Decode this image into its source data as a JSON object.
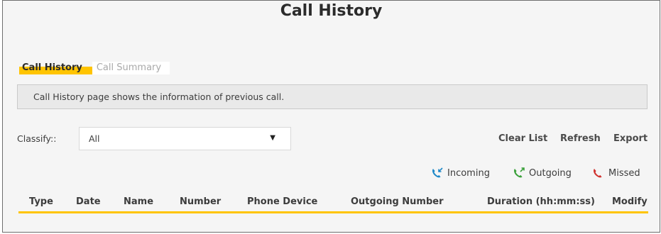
{
  "page": {
    "title": "Call History"
  },
  "tabs": [
    {
      "label": "Call History",
      "active": true
    },
    {
      "label": "Call Summary",
      "active": false
    }
  ],
  "info": {
    "text": "Call History page shows the information of previous call."
  },
  "classify": {
    "label": "Classify::",
    "selected": "All"
  },
  "actions": {
    "clear_label": "Clear List",
    "refresh_label": "Refresh",
    "export_label": "Export"
  },
  "legend": {
    "incoming": {
      "label": "Incoming",
      "icon": "incoming-call-icon",
      "color": "#1e88c7"
    },
    "outgoing": {
      "label": "Outgoing",
      "icon": "outgoing-call-icon",
      "color": "#3aa03a"
    },
    "missed": {
      "label": "Missed",
      "icon": "missed-call-icon",
      "color": "#d0312d"
    }
  },
  "table": {
    "columns": [
      "Type",
      "Date",
      "Name",
      "Number",
      "Phone Device",
      "Outgoing Number",
      "Duration (hh:mm:ss)",
      "Modify"
    ],
    "rows": []
  },
  "colors": {
    "accent": "#ffc400",
    "background": "#f5f5f5",
    "border": "#6e6e6e"
  }
}
